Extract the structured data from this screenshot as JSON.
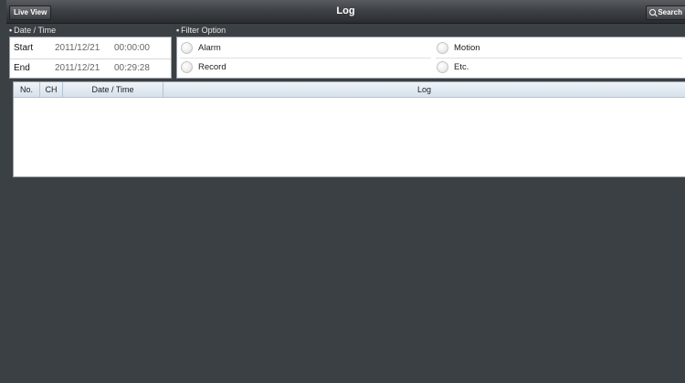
{
  "header": {
    "live_view_label": "Live View",
    "title": "Log",
    "search_label": "Search"
  },
  "date_time": {
    "section_label": "Date / Time",
    "start_label": "Start",
    "start_date": "2011/12/21",
    "start_time": "00:00:00",
    "end_label": "End",
    "end_date": "2011/12/21",
    "end_time": "00:29:28"
  },
  "filter": {
    "section_label": "Filter Option",
    "options": [
      "Alarm",
      "Record",
      "Motion",
      "Etc."
    ]
  },
  "log_table": {
    "columns": [
      "No.",
      "CH",
      "Date / Time",
      "Log"
    ],
    "rows": []
  },
  "colors": {
    "background": "#3b4045",
    "header_bar": "#3e4246",
    "table_header": "#dfe8f1"
  }
}
